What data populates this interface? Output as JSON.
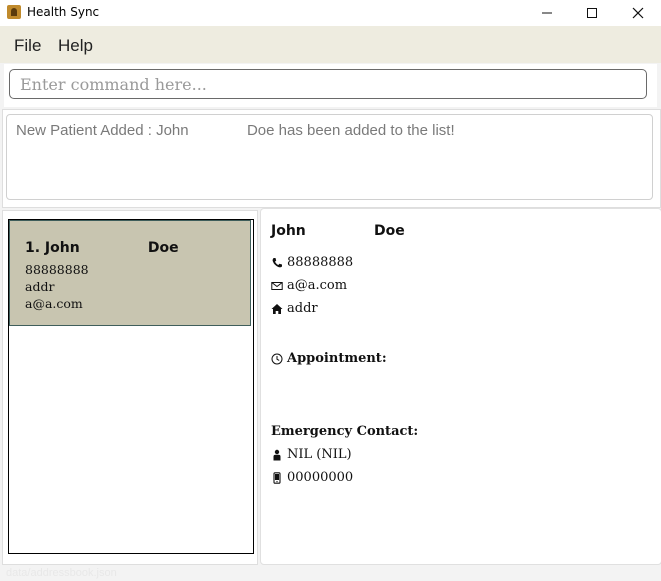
{
  "window": {
    "title": "Health Sync"
  },
  "menu": {
    "file": "File",
    "help": "Help"
  },
  "command": {
    "placeholder": "Enter command here...",
    "value": ""
  },
  "result": {
    "message": "New Patient Added : John              Doe has been added to the list!"
  },
  "patients": [
    {
      "index_name": "1. John              Doe",
      "phone": "88888888",
      "address": "addr",
      "email": "a@a.com"
    }
  ],
  "detail": {
    "name": "John              Doe",
    "phone": "88888888",
    "email": "a@a.com",
    "address": "addr",
    "appointment_label": "Appointment:",
    "emergency_label": "Emergency Contact:",
    "emergency_name": "NIL  (NIL)",
    "emergency_phone": "00000000"
  },
  "status": {
    "text": "data/addressbook.json"
  },
  "icons": {
    "phone": "phone-icon",
    "email": "envelope-icon",
    "address": "home-icon",
    "appointment": "clock-icon",
    "person": "person-icon",
    "mobile": "mobile-icon"
  }
}
